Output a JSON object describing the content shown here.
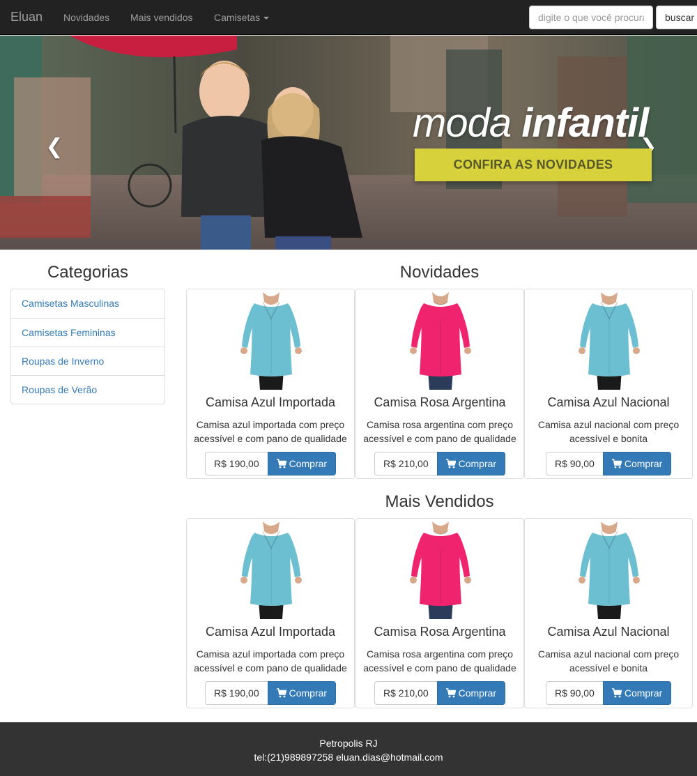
{
  "navbar": {
    "brand": "Eluan",
    "links": [
      "Novidades",
      "Mais vendidos",
      "Camisetas"
    ],
    "search_placeholder": "digite o que você procura",
    "search_button": "buscar"
  },
  "carousel": {
    "headline_light": "moda ",
    "headline_bold": "infantil",
    "cta": "CONFIRA AS NOVIDADES",
    "prev_icon": "chevron-left-icon",
    "next_icon": "chevron-right-icon"
  },
  "sidebar": {
    "title": "Categorias",
    "items": [
      "Camisetas Masculinas",
      "Camisetas Femininas",
      "Roupas de Inverno",
      "Roupas de Verão"
    ]
  },
  "sections": [
    {
      "title": "Novidades",
      "products": [
        {
          "name": "Camisa Azul Importada",
          "description": "Camisa azul importada com preço acessível e com pano de qualidade",
          "price": "R$ 190,00",
          "buy": "Comprar",
          "color": "blue"
        },
        {
          "name": "Camisa Rosa Argentina",
          "description": "Camisa rosa argentina com preço acessível e com pano de qualidade",
          "price": "R$ 210,00",
          "buy": "Comprar",
          "color": "pink"
        },
        {
          "name": "Camisa Azul Nacional",
          "description": "Camisa azul nacional com preço acessível e bonita",
          "price": "R$ 90,00",
          "buy": "Comprar",
          "color": "blue"
        }
      ]
    },
    {
      "title": "Mais Vendidos",
      "products": [
        {
          "name": "Camisa Azul Importada",
          "description": "Camisa azul importada com preço acessível e com pano de qualidade",
          "price": "R$ 190,00",
          "buy": "Comprar",
          "color": "blue"
        },
        {
          "name": "Camisa Rosa Argentina",
          "description": "Camisa rosa argentina com preço acessível e com pano de qualidade",
          "price": "R$ 210,00",
          "buy": "Comprar",
          "color": "pink"
        },
        {
          "name": "Camisa Azul Nacional",
          "description": "Camisa azul nacional com preço acessível e bonita",
          "price": "R$ 90,00",
          "buy": "Comprar",
          "color": "blue"
        }
      ]
    }
  ],
  "footer": {
    "city": "Petropolis RJ",
    "contact": "tel:(21)989897258 eluan.dias@hotmail.com"
  },
  "colors": {
    "navbar_bg": "#222222",
    "link": "#337ab7",
    "primary_button": "#337ab7",
    "footer_bg": "#333333",
    "banner_cta": "#d7d23c",
    "shirt_blue": "#6cbfd0",
    "shirt_pink": "#f0246e"
  }
}
